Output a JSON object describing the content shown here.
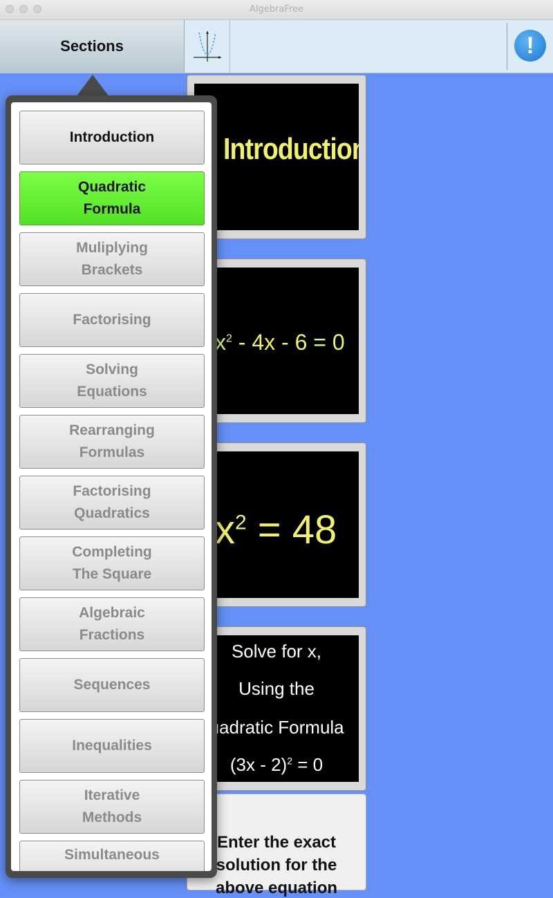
{
  "window": {
    "title": "AlgebraFree"
  },
  "toolbar": {
    "sections_label": "Sections",
    "info_label": "!"
  },
  "cards": {
    "card1": "Introduction",
    "card2_a": "x",
    "card2_sup": "2",
    "card2_b": " - 4x - 6 = 0",
    "card3_a": "x",
    "card3_sup": "2",
    "card3_b": " = 48",
    "card4": {
      "line1": "Solve for x,",
      "line2": "Using the",
      "line3": "Quadratic Formula",
      "line4_a": "(3x - 2)",
      "line4_sup": "2",
      "line4_b": " = 0"
    },
    "card5": {
      "line1": "Enter the exact",
      "line2": "solution for the",
      "line3": "above equation"
    }
  },
  "sections": {
    "items": [
      {
        "label": "Introduction"
      },
      {
        "label": "Quadratic\nFormula"
      },
      {
        "label": "Muliplying\nBrackets"
      },
      {
        "label": "Factorising"
      },
      {
        "label": "Solving\nEquations"
      },
      {
        "label": "Rearranging\nFormulas"
      },
      {
        "label": "Factorising\nQuadratics"
      },
      {
        "label": "Completing\nThe Square"
      },
      {
        "label": "Algebraic\nFractions"
      },
      {
        "label": "Sequences"
      },
      {
        "label": "Inequalities"
      },
      {
        "label": "Iterative\nMethods"
      },
      {
        "label": "Simultaneous"
      }
    ]
  },
  "colors": {
    "background": "#6490f7",
    "active_section": "#66f030",
    "chalk_yellow": "#f1f26a"
  }
}
